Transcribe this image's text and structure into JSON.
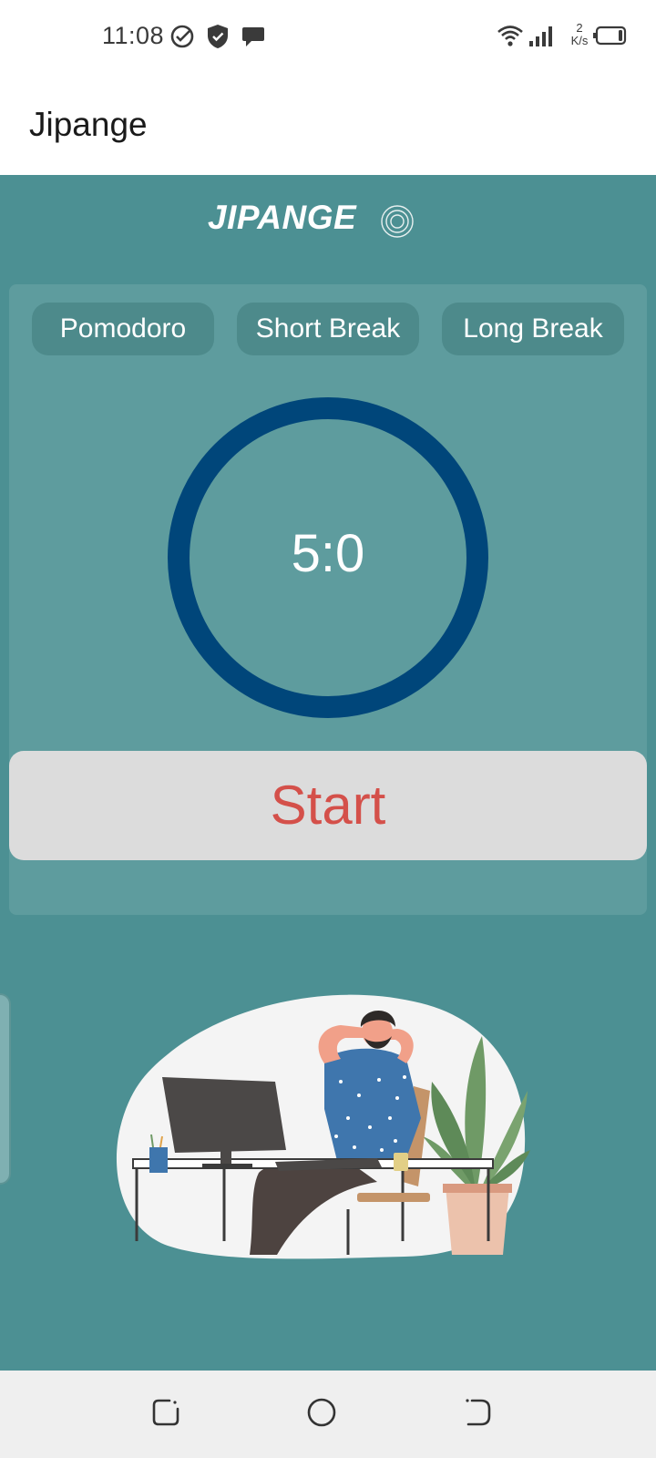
{
  "status_bar": {
    "time": "11:08",
    "icons": [
      "check-circle-icon",
      "shield-icon",
      "chat-bubble-icon",
      "wifi-icon",
      "signal-icon",
      "battery-icon"
    ],
    "net_speed_value": "2",
    "net_speed_unit": "K/s"
  },
  "app_bar": {
    "title": "Jipange"
  },
  "brand": {
    "name": "JIPANGE",
    "logo_icon": "target-rings-icon"
  },
  "mode_tabs": [
    {
      "label": "Pomodoro"
    },
    {
      "label": "Short Break"
    },
    {
      "label": "Long Break"
    }
  ],
  "timer": {
    "display": "5:0",
    "ring_progress": 1.0
  },
  "start_button": {
    "label": "Start"
  },
  "illustration": {
    "icon": "man-relaxing-at-desk-illustration"
  },
  "nav_bar": {
    "icons": [
      "recents-icon",
      "home-icon",
      "back-icon"
    ]
  },
  "colors": {
    "background": "#4c9093",
    "card": "#5e9c9e",
    "tab": "#4d8a8b",
    "ring": "#00467a",
    "start_text": "#d4504a",
    "start_bg": "#dcdcdc"
  }
}
